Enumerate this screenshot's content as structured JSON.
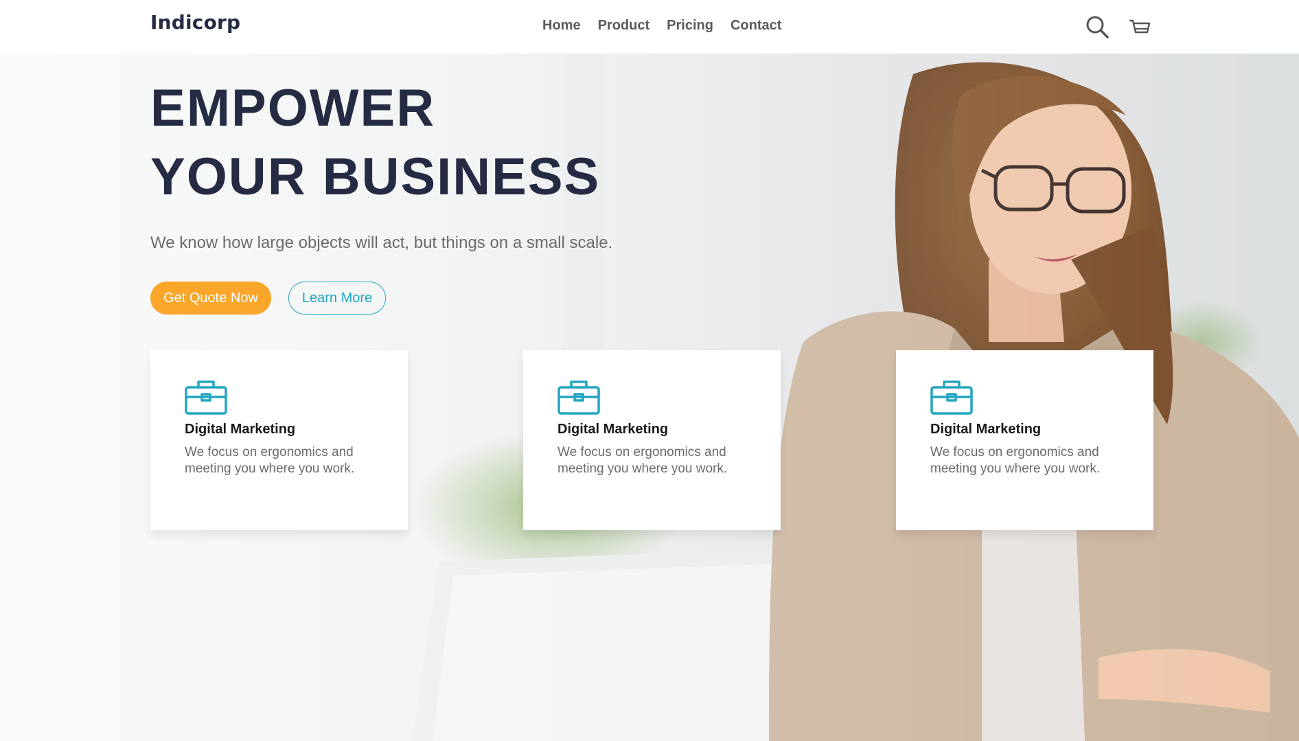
{
  "brand": {
    "name": "Indicorp"
  },
  "nav": {
    "links": [
      {
        "label": "Home"
      },
      {
        "label": "Product"
      },
      {
        "label": "Pricing"
      },
      {
        "label": "Contact"
      }
    ],
    "icons": [
      "search-icon",
      "cart-icon"
    ]
  },
  "hero": {
    "headline_line1": "EMPOWER",
    "headline_line2": "YOUR BUSINESS",
    "subtitle": "We know how large objects will act, but things on a small scale.",
    "primary_button": "Get Quote Now",
    "secondary_button": "Learn More"
  },
  "features": [
    {
      "icon": "briefcase-icon",
      "title": "Digital Marketing",
      "text": "We focus on ergonomics and meeting you where you work."
    },
    {
      "icon": "briefcase-icon",
      "title": "Digital Marketing",
      "text": "We focus on ergonomics and meeting you where you work."
    },
    {
      "icon": "briefcase-icon",
      "title": "Digital Marketing",
      "text": "We focus on ergonomics and meeting you where you work."
    }
  ],
  "colors": {
    "primary_text": "#252b42",
    "accent_orange": "#f9a62b",
    "accent_teal": "#23a6c0",
    "muted_text": "#6b6b6b"
  }
}
